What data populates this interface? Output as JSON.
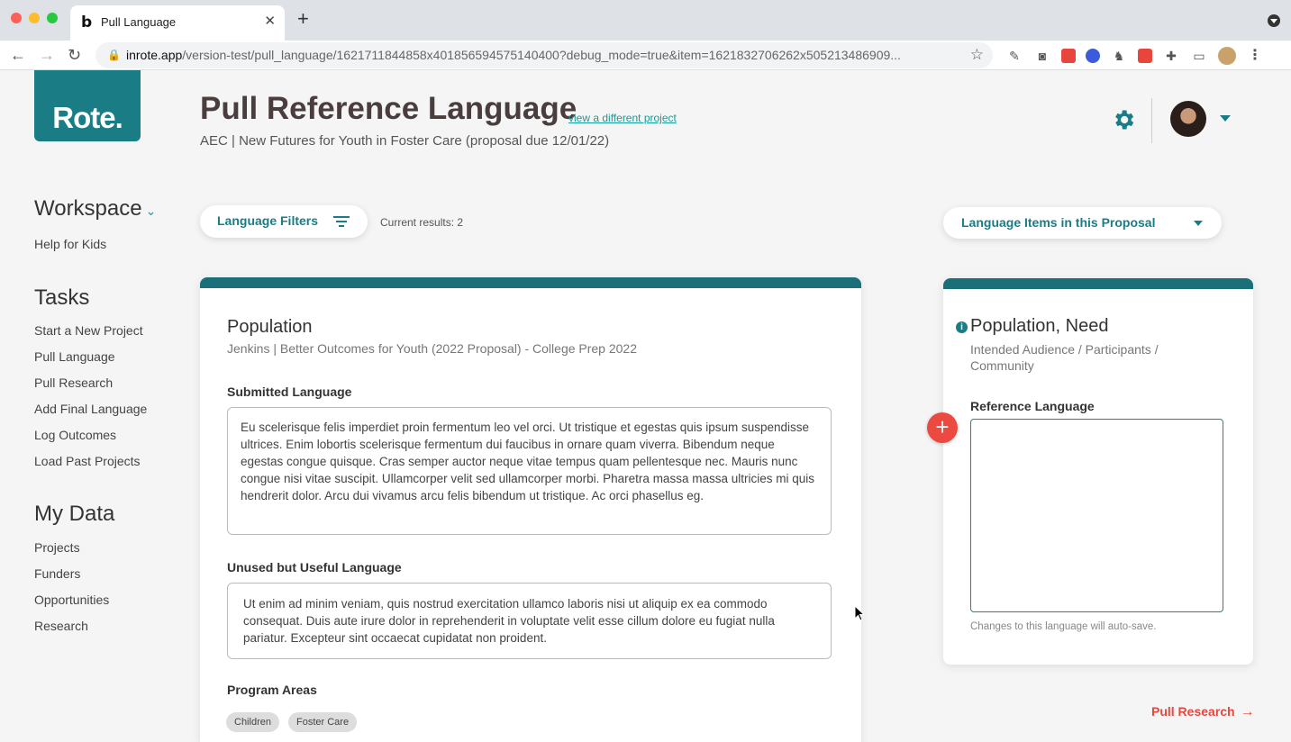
{
  "browser": {
    "tab_title": "Pull Language",
    "tab_favicon": "b",
    "tab_close": "✕",
    "new_tab": "+",
    "url_host": "inrote.app",
    "url_path": "/version-test/pull_language/1621711844858x401856594575140400?debug_mode=true&item=1621832706262x505213486909..."
  },
  "app": {
    "logo_text": "Rote.",
    "page_title": "Pull Reference Language",
    "different_project_link": "view a different project",
    "project_subtitle": "AEC | New Futures for Youth in Foster Care (proposal due 12/01/22)"
  },
  "sidebar": {
    "workspace_heading": "Workspace",
    "workspace_items": [
      "Help for Kids"
    ],
    "tasks_heading": "Tasks",
    "tasks_items": [
      "Start a New Project",
      "Pull Language",
      "Pull Research",
      "Add Final Language",
      "Log Outcomes",
      "Load Past Projects"
    ],
    "mydata_heading": "My Data",
    "mydata_items": [
      "Projects",
      "Funders",
      "Opportunities",
      "Research"
    ]
  },
  "filters": {
    "label": "Language Filters",
    "results_text": "Current results: 2"
  },
  "proposal_dropdown": {
    "label": "Language Items in this Proposal"
  },
  "main_card": {
    "title": "Population",
    "subtitle": "Jenkins | Better Outcomes for Youth (2022 Proposal) - College Prep 2022",
    "submitted_label": "Submitted Language",
    "submitted_text": "Eu scelerisque felis imperdiet proin fermentum leo vel orci. Ut tristique et egestas quis ipsum suspendisse ultrices. Enim lobortis scelerisque fermentum dui faucibus in ornare quam viverra. Bibendum neque egestas congue quisque. Cras semper auctor neque vitae tempus quam pellentesque nec. Mauris nunc congue nisi vitae suscipit. Ullamcorper velit sed ullamcorper morbi. Pharetra massa massa ultricies mi quis hendrerit dolor. Arcu dui vivamus arcu felis bibendum ut tristique. Ac orci phasellus eg.",
    "unused_label": "Unused but Useful Language",
    "unused_text": "Ut enim ad minim veniam, quis nostrud exercitation ullamco laboris nisi ut aliquip ex ea commodo consequat. Duis aute irure dolor in reprehenderit in voluptate velit esse cillum dolore eu fugiat nulla pariatur. Excepteur sint occaecat cupidatat non proident.",
    "program_areas_label": "Program Areas",
    "program_areas": [
      "Children",
      "Foster Care"
    ]
  },
  "side_card": {
    "title": "Population, Need",
    "subtitle_line1": "Intended Audience / Participants /",
    "subtitle_line2": "Community",
    "info_glyph": "i",
    "reference_label": "Reference Language",
    "reference_value": "",
    "autosave_note": "Changes to this language will auto-save.",
    "add_glyph": "+"
  },
  "footer": {
    "pull_research": "Pull Research",
    "arrow": "→"
  },
  "colors": {
    "brand_teal": "#1a7d85",
    "accent_red": "#e8473d"
  }
}
